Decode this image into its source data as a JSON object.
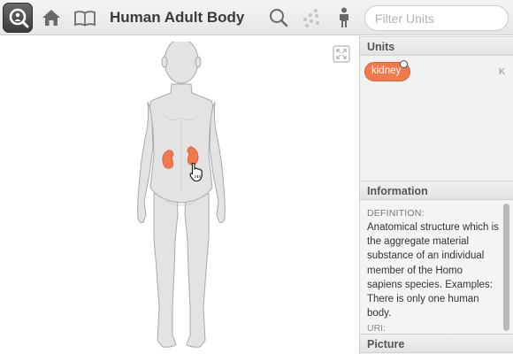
{
  "toolbar": {
    "title": "Human Adult Body",
    "filter_placeholder": "Filter Units",
    "icons": [
      "search-logo-icon",
      "home-icon",
      "book-icon",
      "search-icon",
      "network-icon",
      "person-icon"
    ]
  },
  "viewer": {
    "selected_organ": "kidney",
    "icons": [
      "expand-icon",
      "hand-cursor-icon"
    ],
    "colors": {
      "body": "#e3e3e3",
      "body_outline": "#a9a9a9",
      "organ": "#f07a4d"
    }
  },
  "units": {
    "header": "Units",
    "items": [
      {
        "label": "kidney"
      }
    ],
    "key_hint": "K",
    "chip_color": "#f07a4d"
  },
  "information": {
    "header": "Information",
    "definition_label": "DEFINITION:",
    "definition_text": "Anatomical structure which is the aggregate material substance of an individual member of the Homo sapiens species. Examples: There is only one human body.",
    "uri_label": "URI:"
  },
  "picture": {
    "header": "Picture"
  }
}
